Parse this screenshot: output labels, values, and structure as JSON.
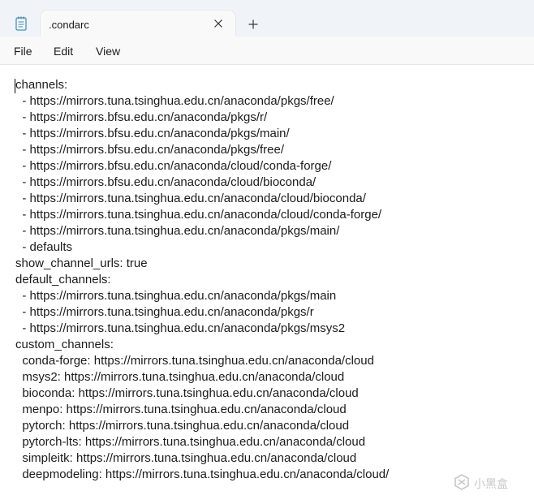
{
  "tab": {
    "title": ".condarc"
  },
  "menu": {
    "file": "File",
    "edit": "Edit",
    "view": "View"
  },
  "editor": {
    "lines": [
      "channels:",
      "  - https://mirrors.tuna.tsinghua.edu.cn/anaconda/pkgs/free/",
      "  - https://mirrors.bfsu.edu.cn/anaconda/pkgs/r/",
      "  - https://mirrors.bfsu.edu.cn/anaconda/pkgs/main/",
      "  - https://mirrors.bfsu.edu.cn/anaconda/pkgs/free/",
      "  - https://mirrors.bfsu.edu.cn/anaconda/cloud/conda-forge/",
      "  - https://mirrors.bfsu.edu.cn/anaconda/cloud/bioconda/",
      "  - https://mirrors.tuna.tsinghua.edu.cn/anaconda/cloud/bioconda/",
      "  - https://mirrors.tuna.tsinghua.edu.cn/anaconda/cloud/conda-forge/",
      "  - https://mirrors.tuna.tsinghua.edu.cn/anaconda/pkgs/main/",
      "  - defaults",
      "show_channel_urls: true",
      "default_channels:",
      "  - https://mirrors.tuna.tsinghua.edu.cn/anaconda/pkgs/main",
      "  - https://mirrors.tuna.tsinghua.edu.cn/anaconda/pkgs/r",
      "  - https://mirrors.tuna.tsinghua.edu.cn/anaconda/pkgs/msys2",
      "custom_channels:",
      "  conda-forge: https://mirrors.tuna.tsinghua.edu.cn/anaconda/cloud",
      "  msys2: https://mirrors.tuna.tsinghua.edu.cn/anaconda/cloud",
      "  bioconda: https://mirrors.tuna.tsinghua.edu.cn/anaconda/cloud",
      "  menpo: https://mirrors.tuna.tsinghua.edu.cn/anaconda/cloud",
      "  pytorch: https://mirrors.tuna.tsinghua.edu.cn/anaconda/cloud",
      "  pytorch-lts: https://mirrors.tuna.tsinghua.edu.cn/anaconda/cloud",
      "  simpleitk: https://mirrors.tuna.tsinghua.edu.cn/anaconda/cloud",
      "  deepmodeling: https://mirrors.tuna.tsinghua.edu.cn/anaconda/cloud/"
    ]
  },
  "watermark": {
    "text": "小黑盒"
  },
  "icons": {
    "app": "notepad-icon",
    "close": "close-icon",
    "new_tab": "plus-icon",
    "watermark": "xiaoheihe-logo-icon"
  },
  "colors": {
    "titlebar_bg": "#f0f3f8",
    "tab_bg": "#f9f9f9",
    "menubar_bg": "#f9f9f9",
    "editor_bg": "#ffffff",
    "text": "#1b1b1b",
    "app_icon_blue": "#3a8fd6"
  }
}
